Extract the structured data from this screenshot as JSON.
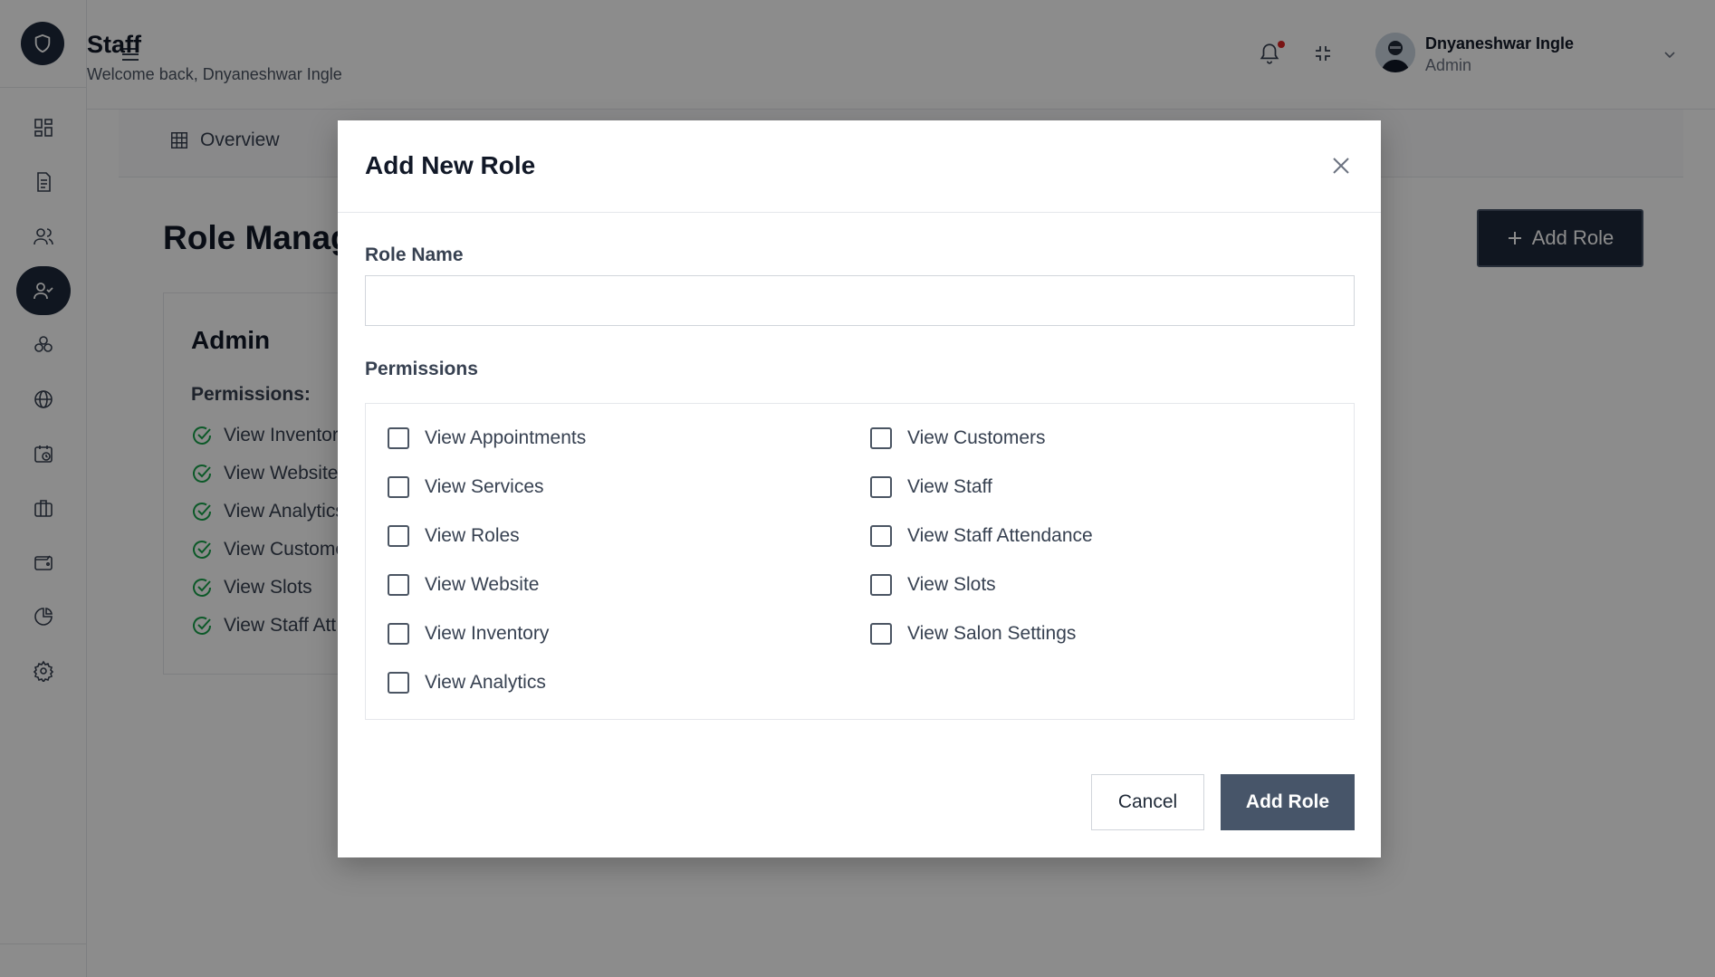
{
  "header": {
    "title": "Staff",
    "subtitle": "Welcome back, Dnyaneshwar Ingle",
    "user_name": "Dnyaneshwar Ingle",
    "user_role": "Admin"
  },
  "sidebar": {
    "items": [
      {
        "icon": "dashboard-icon"
      },
      {
        "icon": "document-icon"
      },
      {
        "icon": "users-icon"
      },
      {
        "icon": "user-check-icon",
        "active": true
      },
      {
        "icon": "cubes-icon"
      },
      {
        "icon": "globe-icon"
      },
      {
        "icon": "calendar-clock-icon"
      },
      {
        "icon": "briefcase-icon"
      },
      {
        "icon": "wallet-icon"
      },
      {
        "icon": "pie-chart-icon"
      },
      {
        "icon": "settings-icon"
      }
    ]
  },
  "tabs": [
    {
      "label": "Overview",
      "icon": "table-icon"
    }
  ],
  "page": {
    "section_title": "Role Manag",
    "add_role_label": "Add Role"
  },
  "role_card": {
    "title": "Admin",
    "permissions_label": "Permissions:",
    "permissions": [
      "View Inventor",
      "View Website",
      "View Analytics",
      "View Custome",
      "View Slots",
      "View Staff Att"
    ]
  },
  "modal": {
    "title": "Add New Role",
    "role_name_label": "Role Name",
    "role_name_value": "",
    "permissions_label": "Permissions",
    "permissions_left": [
      "View Appointments",
      "View Services",
      "View Roles",
      "View Website",
      "View Inventory",
      "View Analytics"
    ],
    "permissions_right": [
      "View Customers",
      "View Staff",
      "View Staff Attendance",
      "View Slots",
      "View Salon Settings"
    ],
    "cancel_label": "Cancel",
    "submit_label": "Add Role"
  },
  "colors": {
    "primary": "#1e293b",
    "submit": "#475569",
    "success": "#16a34a",
    "notification": "#dc2626"
  }
}
